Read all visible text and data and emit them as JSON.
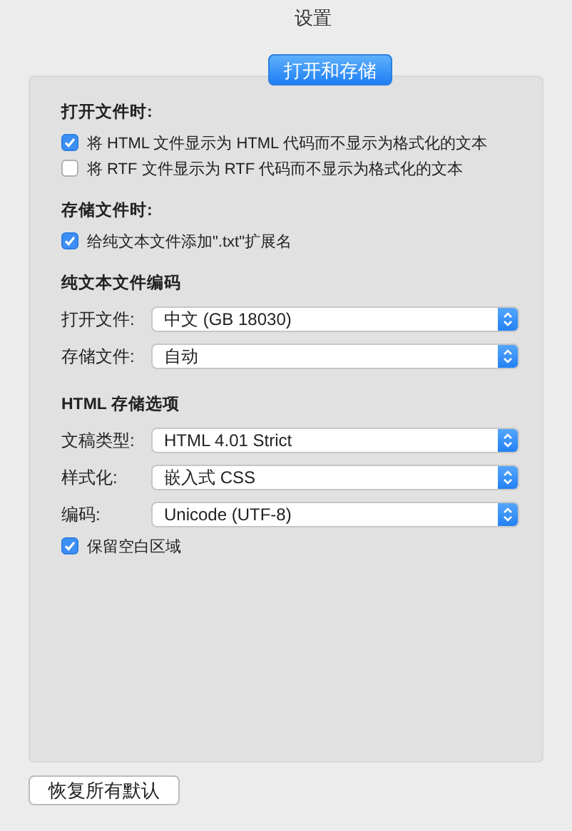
{
  "window": {
    "title": "设置"
  },
  "tabs": [
    {
      "label": "打开和存储",
      "selected": true
    }
  ],
  "sections": [
    {
      "heading": "打开文件时:",
      "rows": [
        {
          "kind": "checkbox",
          "label": "将 HTML 文件显示为 HTML 代码而不显示为格式化的文本",
          "checked": true
        },
        {
          "kind": "checkbox",
          "label": "将 RTF 文件显示为 RTF 代码而不显示为格式化的文本",
          "checked": false
        }
      ]
    },
    {
      "heading": "存储文件时:",
      "rows": [
        {
          "kind": "checkbox",
          "label": "给纯文本文件添加\".txt\"扩展名",
          "checked": true
        }
      ]
    },
    {
      "heading": "纯文本文件编码",
      "rows": [
        {
          "kind": "popup",
          "label": "打开文件:",
          "value": "中文 (GB 18030)"
        },
        {
          "kind": "popup",
          "label": "存储文件:",
          "value": "自动"
        }
      ]
    },
    {
      "heading": "HTML 存储选项",
      "rows": [
        {
          "kind": "popup",
          "label": "文稿类型:",
          "value": "HTML 4.01 Strict"
        },
        {
          "kind": "popup",
          "label": "样式化:",
          "value": "嵌入式 CSS"
        },
        {
          "kind": "popup",
          "label": "编码:",
          "value": "Unicode (UTF-8)"
        },
        {
          "kind": "checkbox",
          "label": "保留空白区域",
          "checked": true
        }
      ]
    }
  ],
  "buttons": [
    {
      "label": "恢复所有默认"
    }
  ]
}
